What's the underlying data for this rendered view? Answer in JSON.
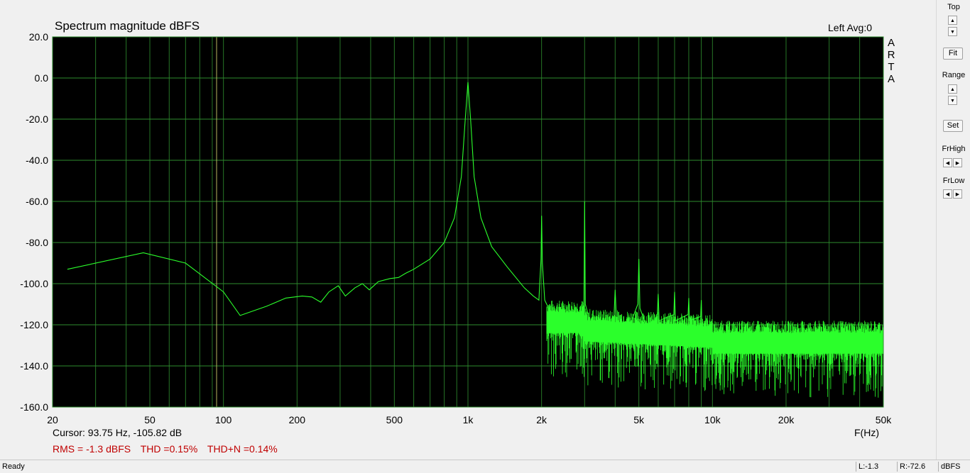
{
  "title": "Spectrum magnitude dBFS",
  "channel_text": "Left  Avg:0",
  "brand": [
    "A",
    "R",
    "T",
    "A"
  ],
  "cursor_text": "Cursor: 93.75 Hz, -105.82 dB",
  "xaxis_unit": "F(Hz)",
  "stats": {
    "rms": "RMS =   -1.3 dBFS",
    "thd": "THD =0.15%",
    "thdn": "THD+N =0.14%"
  },
  "colors": {
    "plot_bg": "#000000",
    "grid": "#2e8b2e",
    "trace": "#2bff2b",
    "cursor": "#b8b860",
    "stats_text": "#c00000"
  },
  "chart_data": {
    "type": "line",
    "title": "Spectrum magnitude dBFS",
    "xlabel": "F(Hz)",
    "ylabel": "",
    "xscale": "log",
    "xlim": [
      20,
      50000
    ],
    "ylim": [
      -160,
      20
    ],
    "yticks": [
      "20.0",
      "0.0",
      "-20.0",
      "-40.0",
      "-60.0",
      "-80.0",
      "-100.0",
      "-120.0",
      "-140.0",
      "-160.0"
    ],
    "ytick_values": [
      20,
      0,
      -20,
      -40,
      -60,
      -80,
      -100,
      -120,
      -140,
      -160
    ],
    "xticks": [
      "20",
      "50",
      "100",
      "200",
      "500",
      "1k",
      "2k",
      "5k",
      "10k",
      "20k",
      "50k"
    ],
    "xtick_values": [
      20,
      50,
      100,
      200,
      500,
      1000,
      2000,
      5000,
      10000,
      20000,
      50000
    ],
    "cursor_x": 93.75,
    "grid": true,
    "series": [
      {
        "points": [
          [
            23,
            -93
          ],
          [
            47,
            -85
          ],
          [
            70,
            -90
          ],
          [
            100,
            -104
          ],
          [
            117,
            -115.5
          ],
          [
            150,
            -111
          ],
          [
            180,
            -107
          ],
          [
            210,
            -106
          ],
          [
            230,
            -106.5
          ],
          [
            250,
            -109
          ],
          [
            270,
            -104
          ],
          [
            295,
            -101
          ],
          [
            315,
            -106
          ],
          [
            345,
            -102
          ],
          [
            370,
            -100
          ],
          [
            395,
            -103
          ],
          [
            430,
            -99
          ],
          [
            480,
            -97.5
          ],
          [
            520,
            -97
          ],
          [
            555,
            -95
          ],
          [
            600,
            -93
          ],
          [
            700,
            -88
          ],
          [
            800,
            -80
          ],
          [
            880,
            -68
          ],
          [
            940,
            -48
          ],
          [
            975,
            -20
          ],
          [
            1000,
            -2
          ],
          [
            1025,
            -20
          ],
          [
            1060,
            -48
          ],
          [
            1130,
            -68
          ],
          [
            1250,
            -82
          ],
          [
            1450,
            -92
          ],
          [
            1700,
            -102
          ],
          [
            1850,
            -106
          ],
          [
            1950,
            -108
          ],
          [
            1990,
            -88
          ],
          [
            2000,
            -67
          ],
          [
            2015,
            -90
          ],
          [
            2060,
            -108
          ],
          [
            2200,
            -115
          ],
          [
            2500,
            -119
          ],
          [
            2800,
            -121
          ],
          [
            2980,
            -110
          ],
          [
            3000,
            -60
          ],
          [
            3020,
            -110
          ],
          [
            3200,
            -121
          ],
          [
            3600,
            -122
          ],
          [
            3950,
            -118
          ],
          [
            4000,
            -103
          ],
          [
            4050,
            -118
          ],
          [
            4500,
            -123
          ],
          [
            4950,
            -110
          ],
          [
            5000,
            -88
          ],
          [
            5050,
            -112
          ],
          [
            5500,
            -124
          ],
          [
            5950,
            -115
          ],
          [
            6000,
            -105
          ],
          [
            6050,
            -118
          ],
          [
            6950,
            -115
          ],
          [
            7000,
            -104
          ],
          [
            7050,
            -118
          ],
          [
            7950,
            -115
          ],
          [
            8000,
            -107
          ],
          [
            8050,
            -118
          ],
          [
            8950,
            -116
          ],
          [
            9000,
            -108
          ],
          [
            9050,
            -120
          ],
          [
            9500,
            -127
          ],
          [
            10000,
            -125
          ],
          [
            12000,
            -128
          ],
          [
            15000,
            -129
          ],
          [
            20000,
            -130
          ],
          [
            30000,
            -130
          ],
          [
            40000,
            -130
          ],
          [
            50000,
            -130
          ]
        ]
      }
    ]
  },
  "panel": {
    "top_label": "Top",
    "fit_label": "Fit",
    "range_label": "Range",
    "set_label": "Set",
    "frhigh_label": "FrHigh",
    "frlow_label": "FrLow",
    "up_glyph": "▲",
    "down_glyph": "▼",
    "left_glyph": "◀",
    "right_glyph": "▶"
  },
  "statusbar": {
    "ready": "Ready",
    "left_level": "L:-1.3",
    "right_level": "R:-72.6",
    "unit": "dBFS"
  }
}
